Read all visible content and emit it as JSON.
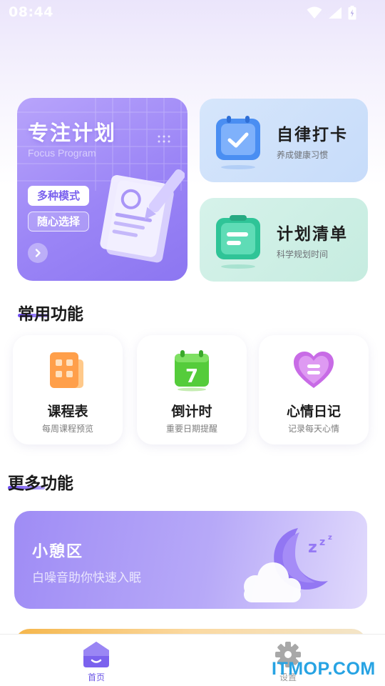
{
  "status_bar": {
    "time": "08:44"
  },
  "focus_card": {
    "title": "专注计划",
    "subtitle": "Focus Program",
    "tag_1": "多种模式",
    "tag_2": "随心选择"
  },
  "checkin_card": {
    "title": "自律打卡",
    "subtitle": "养成健康习惯"
  },
  "plan_card": {
    "title": "计划清单",
    "subtitle": "科学规划时间"
  },
  "common_section": {
    "title": "常用功能",
    "items": [
      {
        "title": "课程表",
        "subtitle": "每周课程预览"
      },
      {
        "title": "倒计时",
        "subtitle": "重要日期提醒",
        "icon_number": "7"
      },
      {
        "title": "心情日记",
        "subtitle": "记录每天心情"
      }
    ]
  },
  "more_section": {
    "title": "更多功能"
  },
  "rest_card": {
    "title": "小憩区",
    "subtitle": "白噪音助你快速入眠"
  },
  "bottom_nav": {
    "home_label": "首页",
    "settings_label": "设置"
  },
  "watermark": "ITMOP.COM",
  "colors": {
    "accent": "#6d4cf0",
    "focus_card": "#9b85f6",
    "checkin_card": "#d0e2fb",
    "plan_card": "#ccefe4",
    "watermark": "#27a3e3"
  }
}
